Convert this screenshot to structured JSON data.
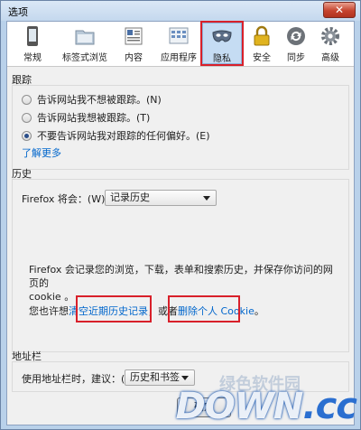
{
  "window": {
    "title": "选项",
    "close_glyph": "✕"
  },
  "tabs": [
    {
      "label": "常规",
      "icon": "phone-icon"
    },
    {
      "label": "标签式浏览",
      "icon": "folder-tabs-icon"
    },
    {
      "label": "内容",
      "icon": "content-icon"
    },
    {
      "label": "应用程序",
      "icon": "applications-icon"
    },
    {
      "label": "隐私",
      "icon": "mask-icon",
      "active": true
    },
    {
      "label": "安全",
      "icon": "lock-icon"
    },
    {
      "label": "同步",
      "icon": "sync-icon"
    },
    {
      "label": "高级",
      "icon": "gear-icon"
    }
  ],
  "tracking": {
    "title": "跟踪",
    "options": [
      "告诉网站我不想被跟踪。(N)",
      "告诉网站我想被跟踪。(T)",
      "不要告诉网站我对跟踪的任何偏好。(E)"
    ],
    "selected_index": 2,
    "learn_more": "了解更多"
  },
  "history": {
    "title": "历史",
    "firefox_will_label": "Firefox 将会：(W)",
    "mode_value": "记录历史",
    "description_line1": "Firefox 会记录您的浏览，下载，表单和搜索历史，并保存你访问的网页的",
    "description_line2": "cookie 。",
    "maybe_prefix": "您也许想",
    "clear_recent_link": "清空近期历史记录",
    "or_text": "，或者",
    "remove_cookies_link": "删除个人 Cookie",
    "end_text": "。"
  },
  "location_bar": {
    "title": "地址栏",
    "suggest_label": "使用地址栏时，建议：(L)",
    "suggest_value": "历史和书签"
  },
  "buttons": {
    "ok": "确定"
  },
  "watermark": {
    "brand": "DOWN",
    "suffix": ".cc",
    "sub": "绿色软件园"
  }
}
